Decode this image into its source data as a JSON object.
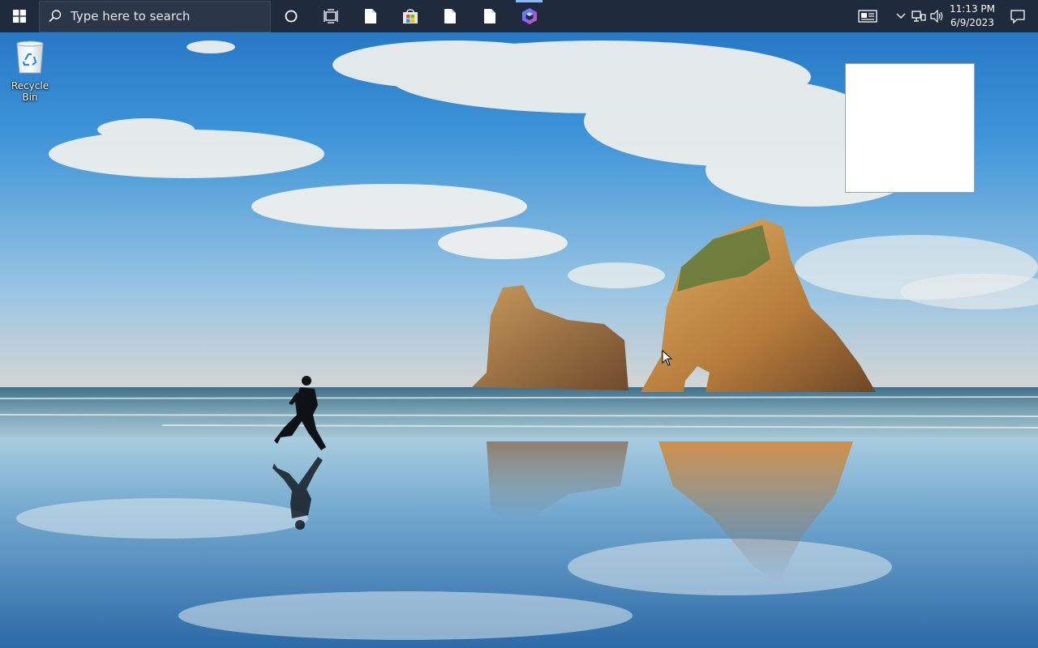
{
  "taskbar": {
    "search": {
      "placeholder": "Type here to search"
    },
    "apps": [
      {
        "name": "cortana-icon"
      },
      {
        "name": "task-view-icon"
      },
      {
        "name": "file-icon"
      },
      {
        "name": "microsoft-store-icon"
      },
      {
        "name": "file-icon"
      },
      {
        "name": "file-icon"
      },
      {
        "name": "copilot-icon",
        "active": true
      }
    ],
    "tray": {
      "icons": [
        "news-widget-icon",
        "chevron-up-icon",
        "network-icon",
        "volume-icon"
      ],
      "time": "11:13 PM",
      "date": "6/9/2023",
      "notification_icon": "notification-icon"
    },
    "colors": {
      "background": "#1f2a3c",
      "active_indicator": "#8fb8ef"
    }
  },
  "desktop": {
    "icons": [
      {
        "label": "Recycle Bin",
        "icon": "recycle-bin-icon"
      }
    ],
    "wallpaper": "beach-rocks-runner"
  },
  "windows": [
    {
      "name": "blank-white-window",
      "content": ""
    }
  ]
}
